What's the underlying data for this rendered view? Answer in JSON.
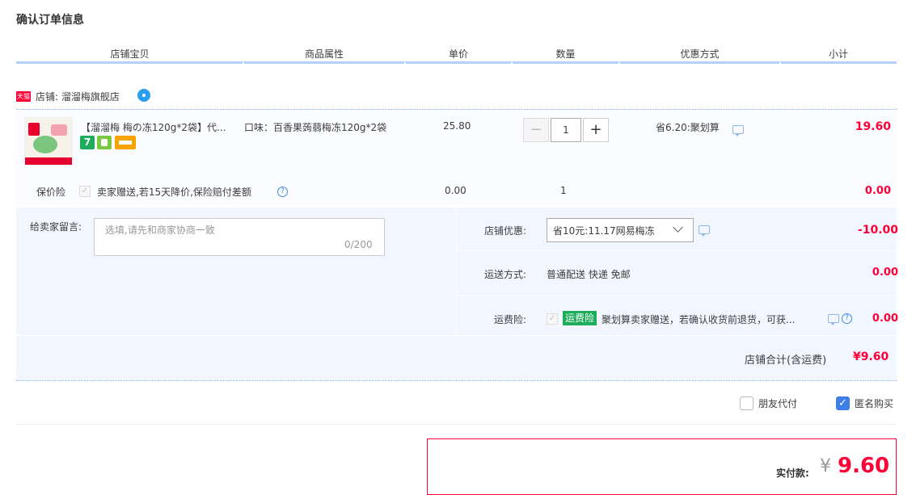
{
  "page_title": "确认订单信息",
  "columns": [
    "店铺宝贝",
    "商品属性",
    "单价",
    "数量",
    "优惠方式",
    "小计"
  ],
  "shop": {
    "tag": "天猫",
    "label": "店铺: 溜溜梅旗舰店"
  },
  "item": {
    "title": "【溜溜梅 梅の冻120g*2袋】代...",
    "attribute": "口味：百香果蒟蒻梅冻120g*2袋",
    "badge_text": "7",
    "price": "25.80",
    "quantity": "1",
    "minus": "−",
    "plus": "+",
    "promo": "省6.20:聚划算",
    "subtotal": "19.60"
  },
  "price_protection": {
    "label": "保价险",
    "text": "卖家赠送,若15天降价,保险赔付差额",
    "price": "0.00",
    "quantity": "1",
    "subtotal": "0.00"
  },
  "message": {
    "label": "给卖家留言:",
    "placeholder": "选填,请先和商家协商一致",
    "count": "0/200"
  },
  "coupon": {
    "label": "店铺优惠:",
    "selected": "省10元:11.17网易梅冻",
    "amount": "-10.00"
  },
  "shipping": {
    "label": "运送方式:",
    "text": "普通配送 快递 免邮",
    "amount": "0.00"
  },
  "freight_insurance": {
    "label": "运费险:",
    "tag": "运费险",
    "text": "聚划算卖家赠送，若确认收货前退货，可获...",
    "amount": "0.00"
  },
  "shop_total": {
    "label": "店铺合计(含运费)",
    "value": "¥9.60"
  },
  "options": {
    "friend_pay": "朋友代付",
    "anonymous": "匿名购买",
    "anonymous_checked": true
  },
  "payment": {
    "label": "实付款:",
    "currency": "¥",
    "value": "9.60"
  },
  "colors": {
    "accent_red": "#ff0036",
    "header_line": "#b2d1ff",
    "green_tag": "#1dad5a"
  }
}
